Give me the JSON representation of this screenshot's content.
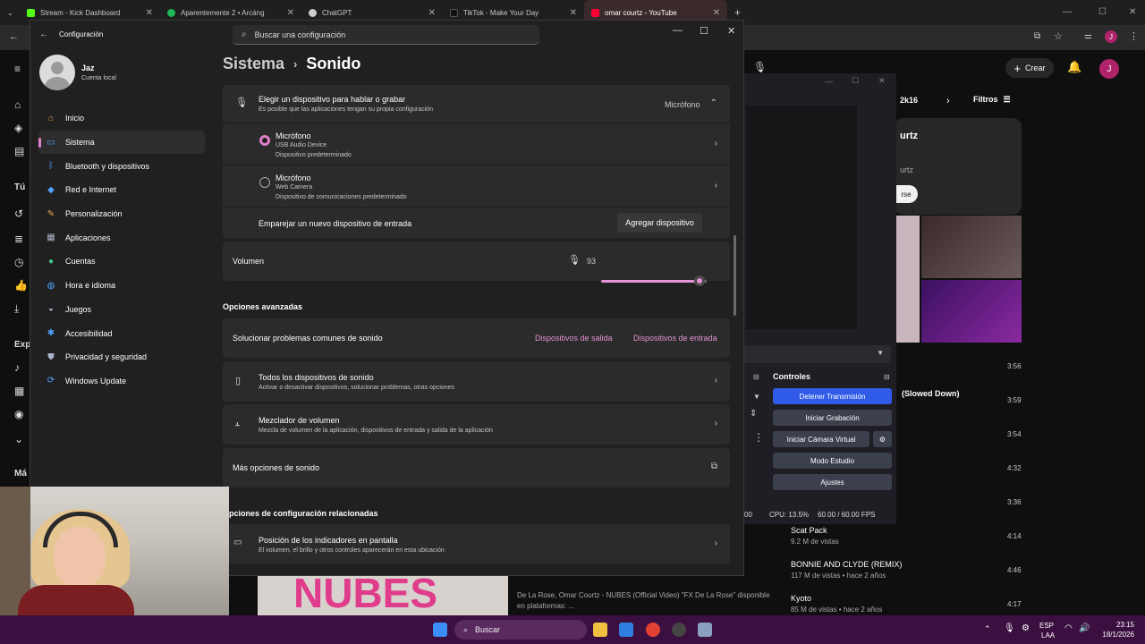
{
  "browser": {
    "tabs": [
      {
        "label": "Stream - Kick Dashboard",
        "color": "#53fc18"
      },
      {
        "label": "Aparentemente 2 • Arcáng",
        "color": "#1db954"
      },
      {
        "label": "ChatGPT",
        "color": "#cccccc"
      },
      {
        "label": "TikTok - Make Your Day",
        "color": "#111111"
      },
      {
        "label": "omar courtz - YouTube",
        "color": "#ff0033"
      }
    ],
    "new_tab": "+"
  },
  "youtube": {
    "create_label": "Crear",
    "avatar_letter": "J",
    "channel_partial": "urtz",
    "handle_partial": "urtz",
    "subscribe_partial": "rse",
    "filters_label": "Filtros",
    "quality_label": "2k16",
    "sidebar_partial": {
      "tu": "Tú",
      "exp": "Exp",
      "mas": "Má"
    },
    "song_partial": "(Slowed Down)",
    "durations": [
      "3:56",
      "3:59",
      "3:54",
      "4:32",
      "3:36",
      "4:14",
      "4:46",
      "4:17"
    ],
    "rows": [
      {
        "title": "Scat Pack",
        "meta": "9.2 M de vistas"
      },
      {
        "title": "BONNIE AND CLYDE (REMIX)",
        "meta": "117 M de vistas • hace 2 años"
      },
      {
        "title": "Kyoto",
        "meta": "85 M de vistas • hace 2 años"
      }
    ],
    "video_desc_line1": "De La Rose, Omar Courtz - NUBES (Official Video) \"FX De La Rose\" disponible",
    "video_desc_line2": "en plataformas: ...",
    "thumb_text": "NUBES"
  },
  "obs": {
    "controls_title": "Controles",
    "buttons": [
      "Detener Transmisión",
      "Iniciar Grabación",
      "Iniciar Cámara Virtual",
      "Modo Estudio",
      "Ajustes"
    ],
    "cpu": "CPU: 13.5%",
    "fps": "60.00 / 60.00 FPS",
    "time_partial": "00"
  },
  "settings": {
    "window_title": "Configuración",
    "search_placeholder": "Buscar una configuración",
    "user": {
      "name": "Jaz",
      "account": "Cuenta local"
    },
    "nav": [
      {
        "label": "Inicio",
        "icon": "home-icon",
        "color": "#e8a84c"
      },
      {
        "label": "Sistema",
        "icon": "system-icon",
        "color": "#4fa3ff"
      },
      {
        "label": "Bluetooth y dispositivos",
        "icon": "bluetooth-icon",
        "color": "#4fa3ff"
      },
      {
        "label": "Red e Internet",
        "icon": "wifi-icon",
        "color": "#4fa3ff"
      },
      {
        "label": "Personalización",
        "icon": "brush-icon",
        "color": "#e8a84c"
      },
      {
        "label": "Aplicaciones",
        "icon": "apps-icon",
        "color": "#aab4c8"
      },
      {
        "label": "Cuentas",
        "icon": "accounts-icon",
        "color": "#3ec98a"
      },
      {
        "label": "Hora e idioma",
        "icon": "globe-clock-icon",
        "color": "#4fa3ff"
      },
      {
        "label": "Juegos",
        "icon": "gamepad-icon",
        "color": "#aab4c8"
      },
      {
        "label": "Accesibilidad",
        "icon": "accessibility-icon",
        "color": "#4fa3ff"
      },
      {
        "label": "Privacidad y seguridad",
        "icon": "shield-icon",
        "color": "#aab4c8"
      },
      {
        "label": "Windows Update",
        "icon": "update-icon",
        "color": "#4fa3ff"
      }
    ],
    "breadcrumb": {
      "parent": "Sistema",
      "current": "Sonido"
    },
    "input_header": {
      "title": "Elegir un dispositivo para hablar o grabar",
      "sub": "Es posible que las aplicaciones tengan su propia configuración",
      "value": "Micrófono"
    },
    "devices": [
      {
        "name": "Micrófono",
        "type": "USB Audio Device",
        "status": "Dispositivo predeterminado",
        "selected": true
      },
      {
        "name": "Micrófono",
        "type": "Web Camera",
        "status": "Dispositivo de comunicaciones predeterminado",
        "selected": false
      }
    ],
    "pair": {
      "label": "Emparejar un nuevo dispositivo de entrada",
      "button": "Agregar dispositivo"
    },
    "volume": {
      "label": "Volumen",
      "value": "93",
      "level": 0.93
    },
    "advanced_title": "Opciones avanzadas",
    "troubleshoot": {
      "label": "Solucionar problemas comunes de sonido",
      "link_out": "Dispositivos de salida",
      "link_in": "Dispositivos de entrada"
    },
    "all_devices": {
      "title": "Todos los dispositivos de sonido",
      "sub": "Activar o desactivar dispositivos, solucionar problemas, otras opciones"
    },
    "mixer": {
      "title": "Mezclador de volumen",
      "sub": "Mezcla de volumen de la aplicación, dispositivos de entrada y salida de la aplicación"
    },
    "more": {
      "label": "Más opciones de sonido"
    },
    "related_title": "Opciones de configuración relacionadas",
    "indicators": {
      "title": "Posición de los indicadores en pantalla",
      "sub": "El volumen, el brillo y otros controles aparecerán en esta ubicación"
    }
  },
  "taskbar": {
    "search": "Buscar",
    "lang1": "ESP",
    "lang2": "LAA",
    "time": "23:15",
    "date": "18/1/2026"
  },
  "accent": "#e394d6"
}
